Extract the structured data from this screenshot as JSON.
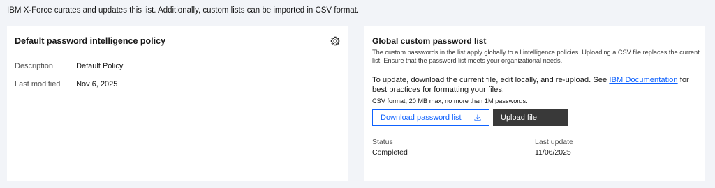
{
  "intro_text": "IBM X-Force curates and updates this list. Additionally, custom lists can be imported in CSV format.",
  "policy_card": {
    "title": "Default password intelligence policy",
    "settings_icon": "gear-icon",
    "rows": [
      {
        "label": "Description",
        "value": "Default Policy"
      },
      {
        "label": "Last modified",
        "value": "Nov 6, 2025"
      }
    ]
  },
  "custom_list_card": {
    "title": "Global custom password list",
    "description": "The custom passwords in the list apply globally to all intelligence policies. Uploading a CSV file replaces the current list. Ensure that the password list meets your organizational needs.",
    "update_prefix": "To update, download the current file, edit locally, and re-upload. See ",
    "update_link": "IBM Documentation",
    "update_suffix": " for best practices for formatting your files.",
    "format_note": "CSV format, 20 MB max, no more than 1M passwords.",
    "download_label": "Download password list",
    "download_icon": "download-icon",
    "upload_label": "Upload file",
    "status_label": "Status",
    "status_value": "Completed",
    "last_update_label": "Last update",
    "last_update_value": "11/06/2025"
  },
  "colors": {
    "page_bg": "#f2f4f8",
    "card_bg": "#ffffff",
    "link": "#0f62fe",
    "upload_button": "#393939"
  }
}
